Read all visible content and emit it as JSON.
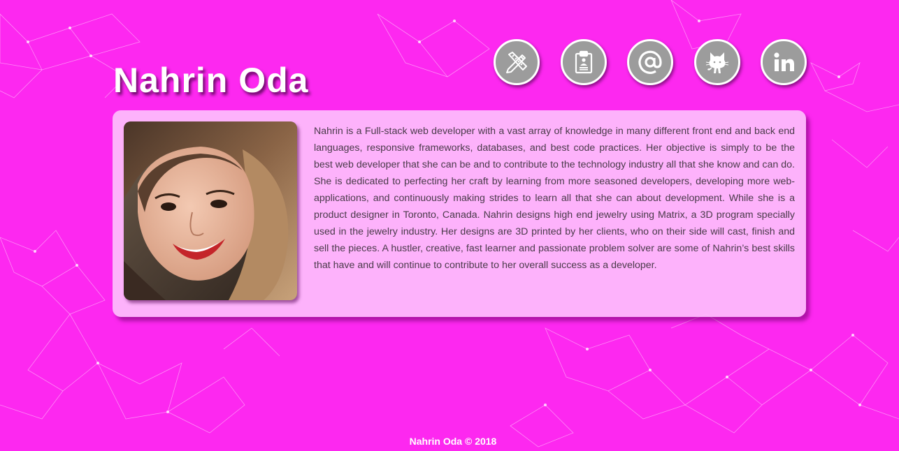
{
  "header": {
    "name": "Nahrin Oda"
  },
  "nav_icons": [
    {
      "name": "portfolio",
      "icon": "pencil-ruler-icon"
    },
    {
      "name": "resume",
      "icon": "clipboard-icon"
    },
    {
      "name": "email",
      "icon": "at-sign-icon"
    },
    {
      "name": "github",
      "icon": "github-octocat-icon"
    },
    {
      "name": "linkedin",
      "icon": "linkedin-icon"
    }
  ],
  "about": {
    "photo_alt": "portrait-photo",
    "bio": "Nahrin is a Full-stack web developer with a vast array of knowledge in many different front end and back end languages, responsive frameworks, databases, and best code practices. Her objective is simply to be the best web developer that she can be and to contribute to the technology industry all that she know and can do. She is dedicated to perfecting her craft by learning from more seasoned developers, developing more web-applications, and continuously making strides to learn all that she can about development. While she is a product designer in Toronto, Canada. Nahrin designs high end jewelry using Matrix, a 3D program specially used in the jewelry industry. Her designs are 3D printed by her clients, who on their side will cast, finish and sell the pieces. A hustler, creative, fast learner and passionate problem solver are some of Nahrin’s best skills that have and will continue to contribute to her overall success as a developer."
  },
  "footer": {
    "text": "Nahrin Oda © 2018"
  },
  "colors": {
    "background": "#fd28f0",
    "card": "#fdbefc",
    "icon_fill": "#9c9c9c",
    "text": "#4a3a4a"
  }
}
